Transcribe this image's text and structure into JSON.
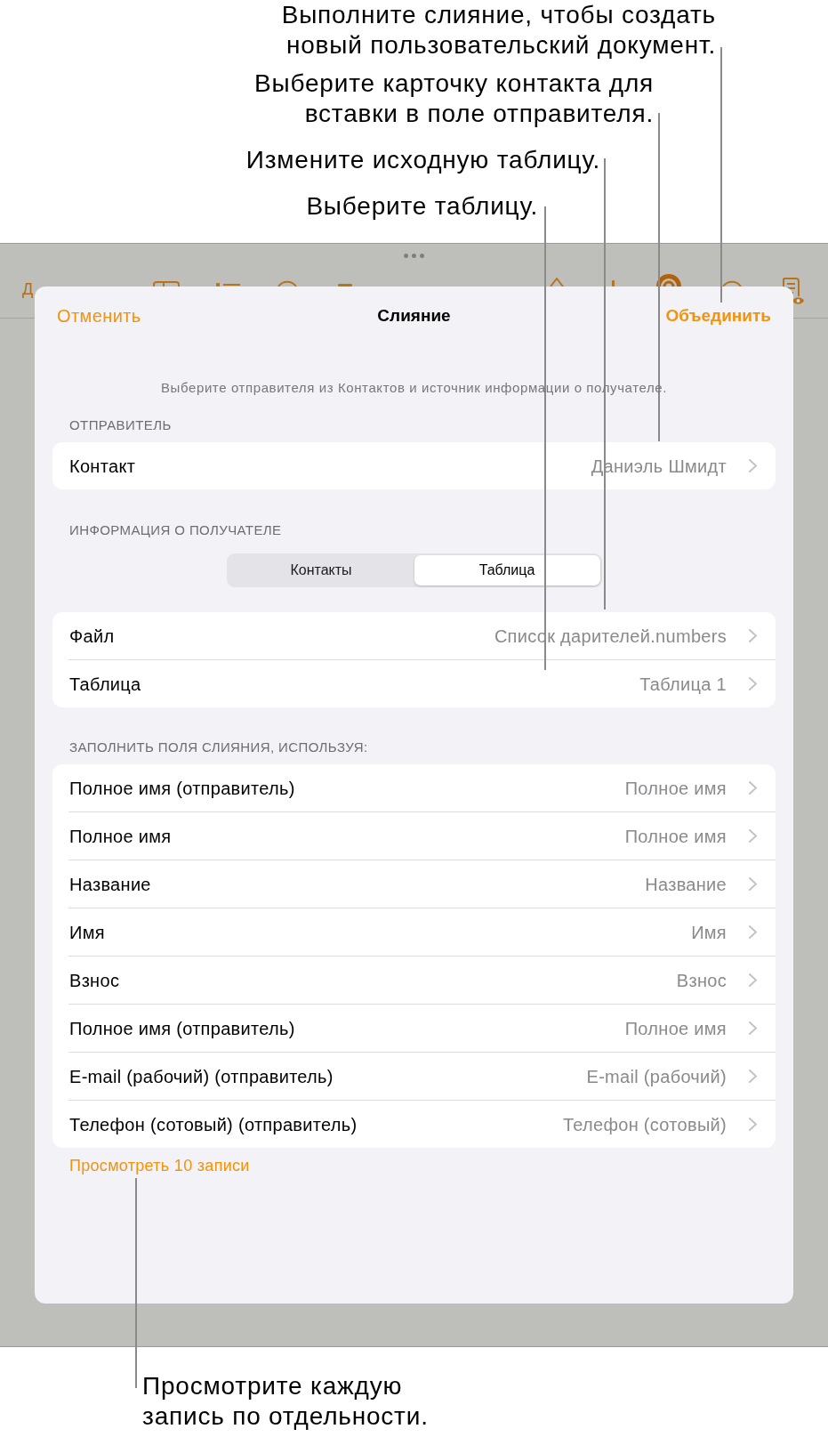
{
  "callouts_top": [
    {
      "lines": [
        "Выполните слияние, чтобы создать",
        "новый пользовательский документ."
      ]
    },
    {
      "lines": [
        "Выберите карточку контакта для",
        "вставки в поле отправителя."
      ]
    },
    {
      "lines": [
        "Измените исходную таблицу."
      ]
    },
    {
      "lines": [
        "Выберите таблицу."
      ]
    }
  ],
  "toolbar": {
    "label": "Д"
  },
  "sheet": {
    "cancel": "Отменить",
    "title": "Слияние",
    "merge": "Объединить",
    "description": "Выберите отправителя из Контактов и источник информации о получателе.",
    "sender": {
      "header": "ОТПРАВИТЕЛЬ",
      "rows": [
        {
          "label": "Контакт",
          "value": "Даниэль Шмидт"
        }
      ]
    },
    "recipient": {
      "header": "ИНФОРМАЦИЯ О ПОЛУЧАТЕЛЕ",
      "segments": [
        {
          "label": "Контакты",
          "selected": false
        },
        {
          "label": "Таблица",
          "selected": true
        }
      ],
      "rows": [
        {
          "label": "Файл",
          "value": "Список дарителей.numbers"
        },
        {
          "label": "Таблица",
          "value": "Таблица 1"
        }
      ]
    },
    "merge_fields": {
      "header": "ЗАПОЛНИТЬ ПОЛЯ СЛИЯНИЯ, ИСПОЛЬЗУЯ:",
      "rows": [
        {
          "label": "Полное имя (отправитель)",
          "value": "Полное имя"
        },
        {
          "label": "Полное имя",
          "value": "Полное имя"
        },
        {
          "label": "Название",
          "value": "Название"
        },
        {
          "label": "Имя",
          "value": "Имя"
        },
        {
          "label": "Взнос",
          "value": "Взнос"
        },
        {
          "label": "Полное имя (отправитель)",
          "value": "Полное имя"
        },
        {
          "label": "E-mail (рабочий) (отправитель)",
          "value": "E-mail (рабочий)"
        },
        {
          "label": "Телефон (сотовый) (отправитель)",
          "value": "Телефон (сотовый)"
        }
      ]
    },
    "preview_link": "Просмотреть 10 записи"
  },
  "callout_bottom": {
    "lines": [
      "Просмотрите каждую",
      "запись по отдельности."
    ]
  }
}
